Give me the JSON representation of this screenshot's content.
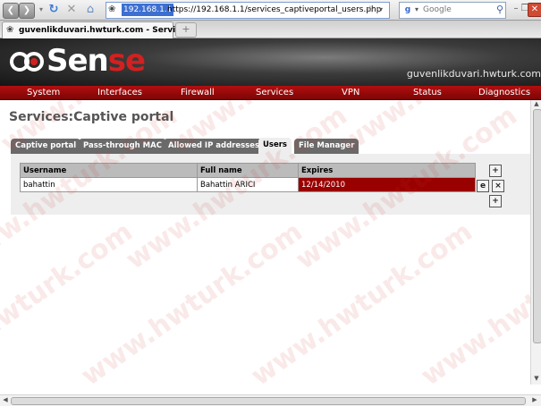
{
  "browser": {
    "address": {
      "host_label": "192.168.1.1",
      "url": "https://192.168.1.1/services_captiveportal_users.php"
    },
    "search": {
      "engine": "g",
      "placeholder": "Google"
    },
    "tab": {
      "title": "guvenlikduvari.hwturk.com - Service..."
    },
    "new_tab": "+"
  },
  "site": {
    "logo_prefix": "Sen",
    "logo_suffix": "se",
    "hostname": "guvenlikduvari.hwturk.com",
    "nav": [
      "System",
      "Interfaces",
      "Firewall",
      "Services",
      "VPN",
      "Status",
      "Diagnostics"
    ]
  },
  "page": {
    "title": "Services:Captive portal",
    "tabs": [
      "Captive portal",
      "Pass-through MAC",
      "Allowed IP addresses",
      "Users",
      "File Manager"
    ],
    "active_tab": "Users"
  },
  "users_table": {
    "headers": [
      "Username",
      "Full name",
      "Expires"
    ],
    "rows": [
      {
        "username": "bahattin",
        "full_name": "Bahattin ARICI",
        "expires": "12/14/2010"
      }
    ]
  },
  "watermark": "www.hwturk.com",
  "colors": {
    "nav_red": "#9c0a0a",
    "expired_red": "#990000",
    "tab_gray": "#6a6a6a",
    "panel_gray": "#eeeeee"
  }
}
